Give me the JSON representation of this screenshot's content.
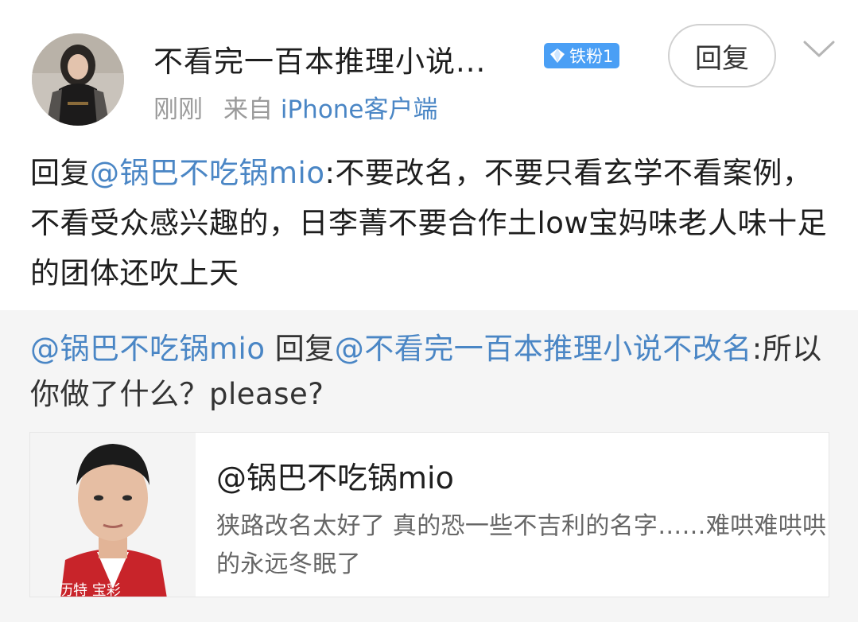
{
  "comment": {
    "username": "不看完一百本推理小说...",
    "badge": "铁粉1",
    "reply_button": "回复",
    "time": "刚刚",
    "source_prefix": "来自",
    "source": "iPhone客户端",
    "text_reply_word": "回复",
    "text_mention": "@锅巴不吃锅mio",
    "text_body": ":不要改名，不要只看玄学不看案例，不看受众感兴趣的，日李菁不要合作土low宝妈味老人味十足的团体还吹上天"
  },
  "quoted": {
    "author_mention": "@锅巴不吃锅mio",
    "reply_word": " 回复",
    "target_mention": "@不看完一百本推理小说不改名",
    "text": ":所以你做了什么？please?"
  },
  "card": {
    "title": "@锅巴不吃锅mio",
    "description": "狭路改名太好了 真的恐一些不吉利的名字……难哄难哄哄的永远冬眠了",
    "thumb_caption": "历特 宝彩"
  },
  "colors": {
    "link_blue": "#4a86c5",
    "badge_blue": "#4a9ff5",
    "quote_bg": "#f5f5f5"
  },
  "icons": {
    "badge_icon": "diamond-icon",
    "expand_icon": "chevron-down-icon"
  }
}
